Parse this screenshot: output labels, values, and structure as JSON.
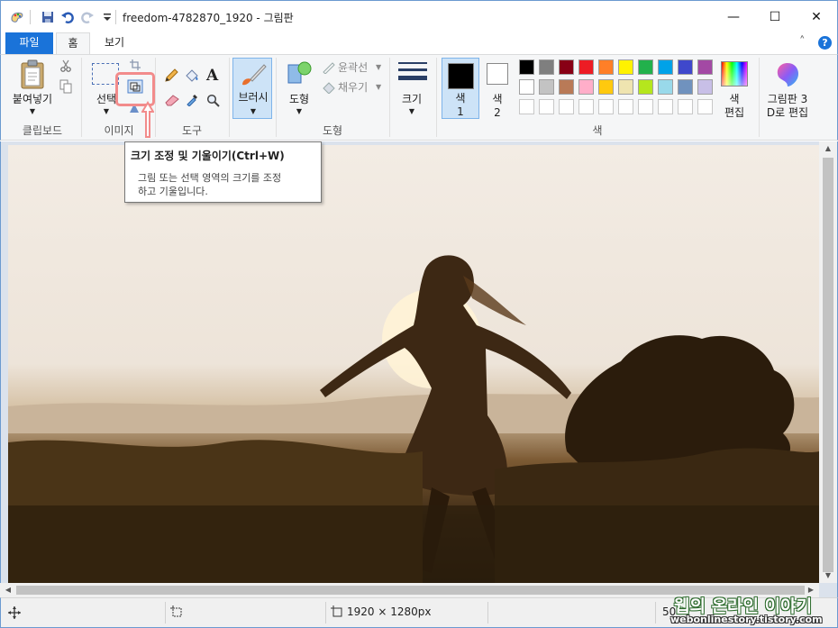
{
  "window": {
    "title": "freedom-4782870_1920 - 그림판",
    "minimize": "—",
    "maximize": "☐",
    "close": "✕"
  },
  "menu": {
    "file": "파일",
    "home": "홈",
    "view": "보기",
    "collapse": "˄",
    "help": "?"
  },
  "ribbon": {
    "clipboard": {
      "paste": "붙여넣기",
      "group": "클립보드"
    },
    "image": {
      "select": "선택",
      "group": "이미지"
    },
    "tools": {
      "group": "도구"
    },
    "brushes": {
      "label": "브러시"
    },
    "shapes": {
      "shapes": "도형",
      "outline": "윤곽선",
      "fill": "채우기",
      "group": "도형"
    },
    "size": {
      "label": "크기"
    },
    "colors": {
      "color1": "색\n1",
      "color1_line1": "색",
      "color1_line2": "1",
      "color2_line1": "색",
      "color2_line2": "2",
      "edit_line1": "색",
      "edit_line2": "편집",
      "group": "색",
      "row1": [
        "#000000",
        "#7f7f7f",
        "#880015",
        "#ed1c24",
        "#ff7f27",
        "#fff200",
        "#22b14c",
        "#00a2e8",
        "#3f48cc",
        "#a349a4"
      ],
      "row2": [
        "#ffffff",
        "#c3c3c3",
        "#b97a57",
        "#ffaec9",
        "#ffc90e",
        "#efe4b0",
        "#b5e61d",
        "#99d9ea",
        "#7092be",
        "#c8bfe7"
      ],
      "row3": [
        "#ffffff",
        "#ffffff",
        "#ffffff",
        "#ffffff",
        "#ffffff",
        "#ffffff",
        "#ffffff",
        "#ffffff",
        "#ffffff",
        "#ffffff"
      ]
    },
    "paint3d": {
      "line1": "그림판 3",
      "line2": "D로 편집"
    }
  },
  "tooltip": {
    "title": "크기 조정 및 기울이기(Ctrl+W)",
    "line1": "그림 또는 선택 영역의 크기를 조정",
    "line2": "하고 기울입니다."
  },
  "status": {
    "dimensions": "1920 × 1280px",
    "zoom": "50"
  },
  "watermark": {
    "line1": "웹의 온라인 이야기",
    "line2": "webonlinestory.tistory.com"
  }
}
